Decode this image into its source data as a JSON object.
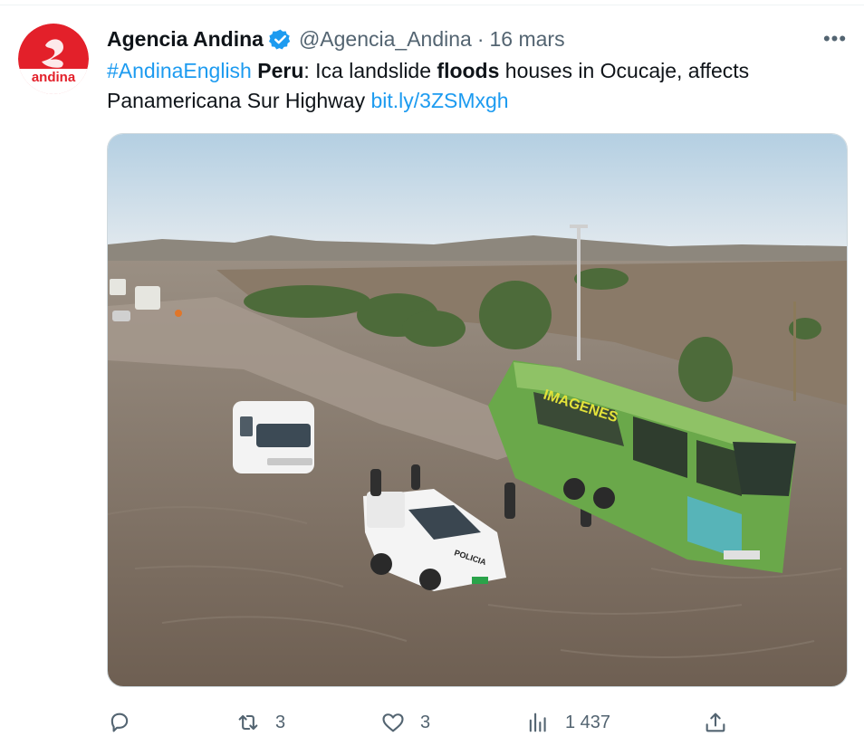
{
  "tweet": {
    "author_name": "Agencia Andina",
    "handle": "@Agencia_Andina",
    "separator": "·",
    "date": "16 mars",
    "avatar_text": "andina",
    "more_label": "•••",
    "text": {
      "hashtag": "#AndinaEnglish",
      "bold1": "Peru",
      "part1": ": Ica landslide ",
      "bold2": "floods",
      "part2": " houses in Ocucaje, affects Panamericana Sur Highway ",
      "link": "bit.ly/3ZSMxgh"
    },
    "image": {
      "bus_text": "IMAGENES",
      "pickup_text": "POLICIA"
    },
    "actions": {
      "reply": {
        "icon": "reply-icon",
        "count": ""
      },
      "retweet": {
        "icon": "retweet-icon",
        "count": "3"
      },
      "like": {
        "icon": "heart-icon",
        "count": "3"
      },
      "views": {
        "icon": "views-icon",
        "count": "1 437"
      },
      "share": {
        "icon": "share-icon",
        "count": ""
      }
    },
    "colors": {
      "link": "#1d9bf0",
      "verified": "#1d9bf0",
      "brand_red": "#e3202a",
      "secondary_text": "#536471"
    }
  }
}
